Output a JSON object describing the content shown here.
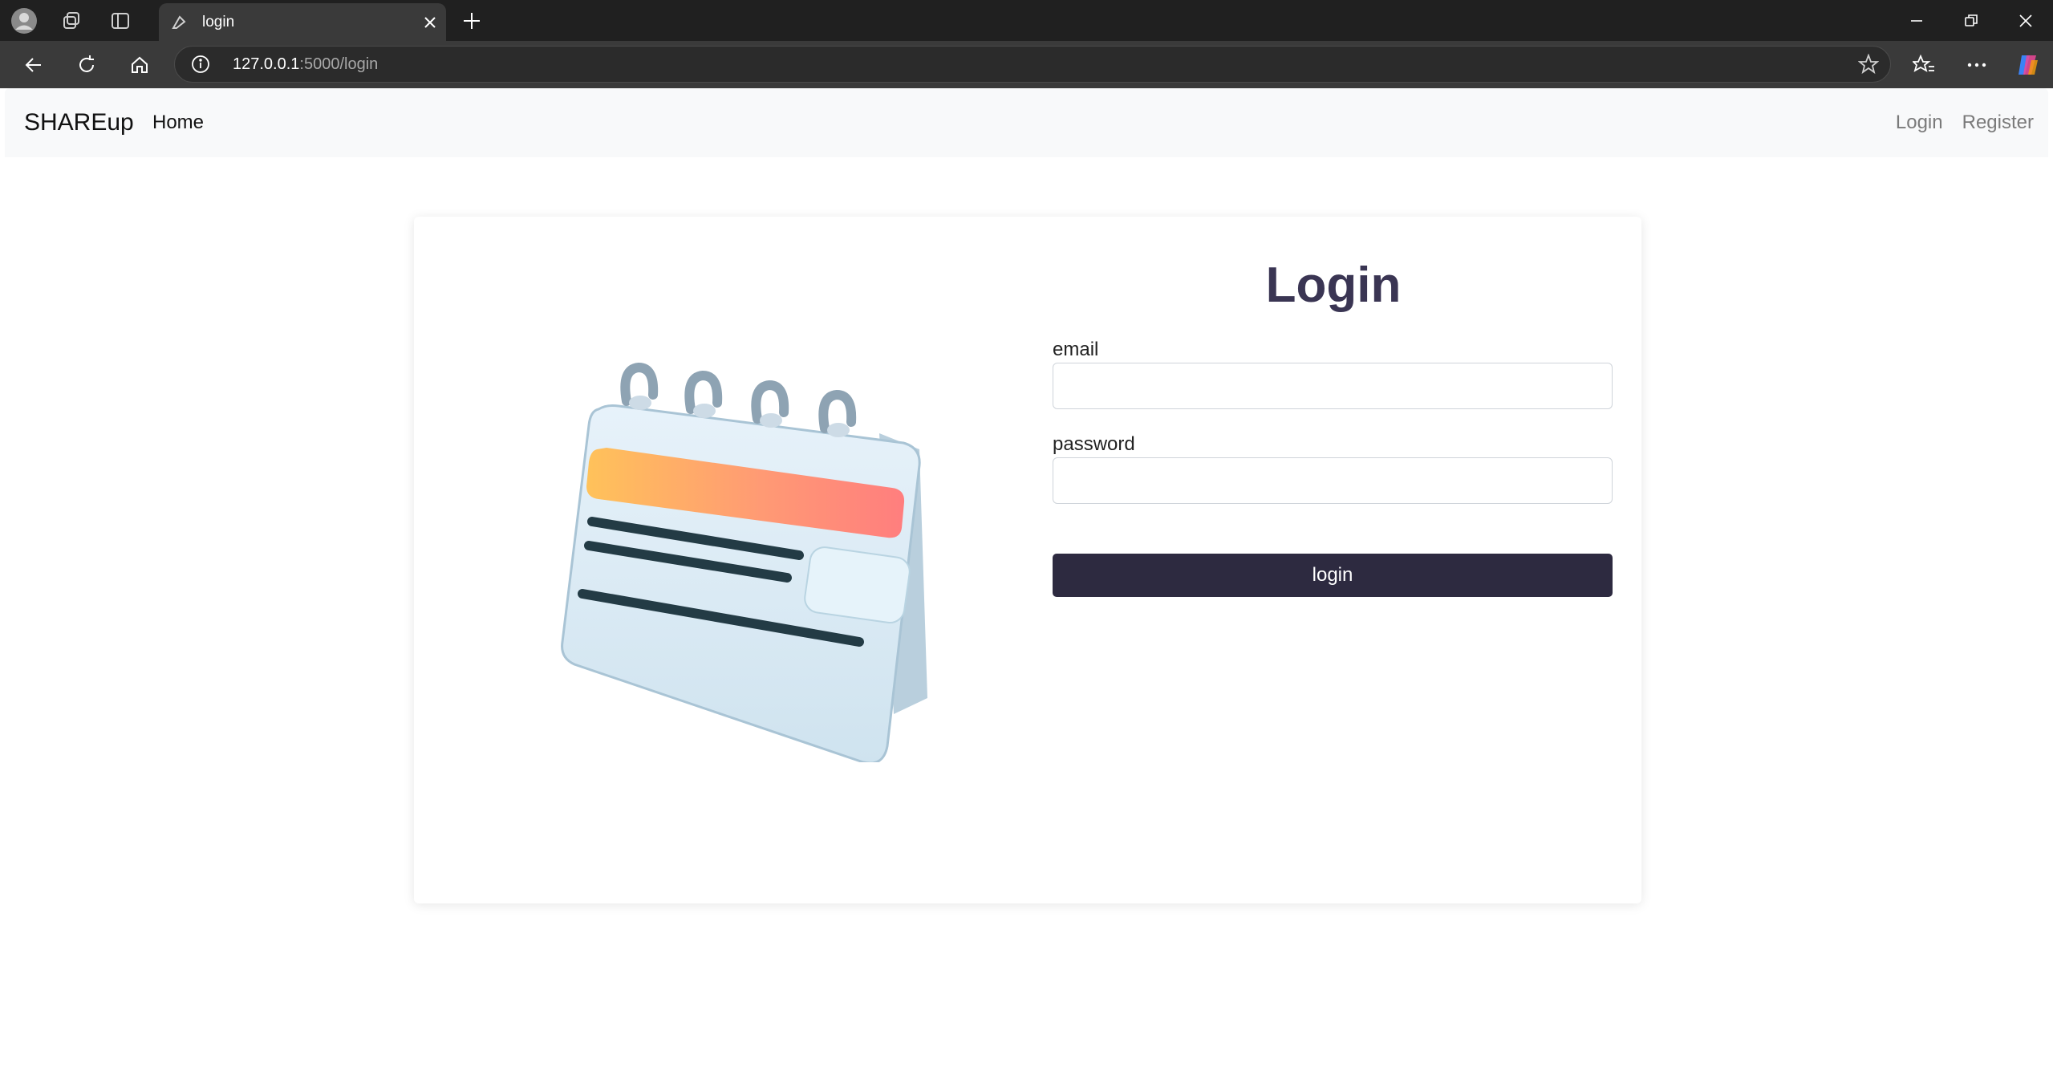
{
  "browser": {
    "tab_title": "login",
    "url_host": "127.0.0.1",
    "url_path": ":5000/login"
  },
  "navbar": {
    "brand": "SHAREup",
    "home": "Home",
    "login": "Login",
    "register": "Register"
  },
  "form": {
    "title": "Login",
    "email_label": "email",
    "email_value": "",
    "password_label": "password",
    "password_value": "",
    "submit_label": "login"
  },
  "colors": {
    "primary_button": "#2d2a40",
    "title": "#3a3553",
    "navbar_bg": "#f8f9fa"
  }
}
